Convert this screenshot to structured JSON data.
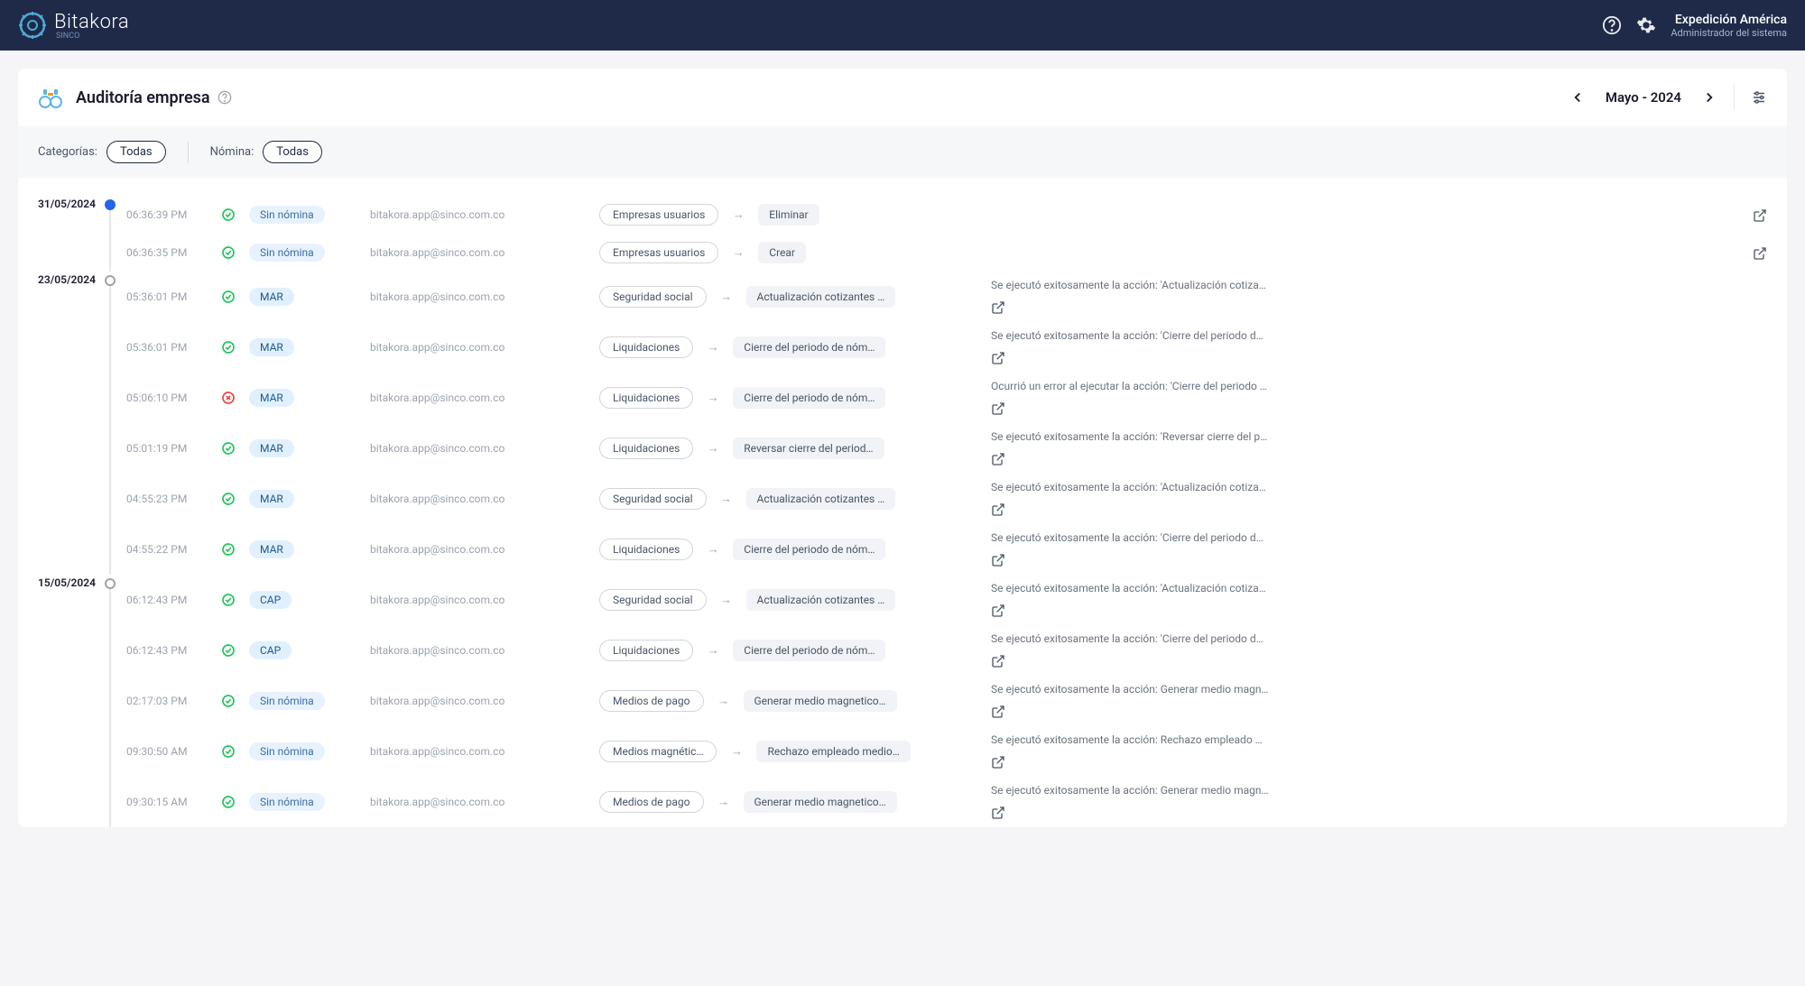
{
  "app": {
    "name": "Bitakora",
    "sub": "SINCO"
  },
  "user": {
    "name": "Expedición América",
    "role": "Administrador del sistema"
  },
  "page": {
    "title": "Auditoría empresa",
    "month": "Mayo - 2024",
    "filters": {
      "cat_label": "Categorías:",
      "cat_value": "Todas",
      "nom_label": "Nómina:",
      "nom_value": "Todas"
    }
  },
  "days": [
    {
      "date": "31/05/2024",
      "filled": true,
      "events": [
        {
          "time": "06:36:39 PM",
          "ok": true,
          "payroll": "Sin nómina",
          "user": "bitakora.app@sinco.com.co",
          "cat": "Empresas usuarios",
          "action": "Eliminar",
          "msg": "",
          "has_open": true
        },
        {
          "time": "06:36:35 PM",
          "ok": true,
          "payroll": "Sin nómina",
          "user": "bitakora.app@sinco.com.co",
          "cat": "Empresas usuarios",
          "action": "Crear",
          "msg": "",
          "has_open": true
        }
      ]
    },
    {
      "date": "23/05/2024",
      "filled": false,
      "events": [
        {
          "time": "05:36:01 PM",
          "ok": true,
          "payroll": "MAR",
          "user": "bitakora.app@sinco.com.co",
          "cat": "Seguridad social",
          "action": "Actualización cotizantes …",
          "msg": "Se ejecutó exitosamente la acción: 'Actualización cotiza…",
          "has_open": true
        },
        {
          "time": "05:36:01 PM",
          "ok": true,
          "payroll": "MAR",
          "user": "bitakora.app@sinco.com.co",
          "cat": "Liquidaciones",
          "action": "Cierre del periodo de nóm…",
          "msg": "Se ejecutó exitosamente la acción: 'Cierre del periodo d…",
          "has_open": true
        },
        {
          "time": "05:06:10 PM",
          "ok": false,
          "payroll": "MAR",
          "user": "bitakora.app@sinco.com.co",
          "cat": "Liquidaciones",
          "action": "Cierre del periodo de nóm…",
          "msg": "Ocurrió un error al ejecutar la acción: 'Cierre del periodo …",
          "has_open": true
        },
        {
          "time": "05:01:19 PM",
          "ok": true,
          "payroll": "MAR",
          "user": "bitakora.app@sinco.com.co",
          "cat": "Liquidaciones",
          "action": "Reversar cierre del period…",
          "msg": "Se ejecutó exitosamente la acción: 'Reversar cierre del p…",
          "has_open": true
        },
        {
          "time": "04:55:23 PM",
          "ok": true,
          "payroll": "MAR",
          "user": "bitakora.app@sinco.com.co",
          "cat": "Seguridad social",
          "action": "Actualización cotizantes …",
          "msg": "Se ejecutó exitosamente la acción: 'Actualización cotiza…",
          "has_open": true
        },
        {
          "time": "04:55:22 PM",
          "ok": true,
          "payroll": "MAR",
          "user": "bitakora.app@sinco.com.co",
          "cat": "Liquidaciones",
          "action": "Cierre del periodo de nóm…",
          "msg": "Se ejecutó exitosamente la acción: 'Cierre del periodo d…",
          "has_open": true
        }
      ]
    },
    {
      "date": "15/05/2024",
      "filled": false,
      "events": [
        {
          "time": "06:12:43 PM",
          "ok": true,
          "payroll": "CAP",
          "user": "bitakora.app@sinco.com.co",
          "cat": "Seguridad social",
          "action": "Actualización cotizantes …",
          "msg": "Se ejecutó exitosamente la acción: 'Actualización cotiza…",
          "has_open": true
        },
        {
          "time": "06:12:43 PM",
          "ok": true,
          "payroll": "CAP",
          "user": "bitakora.app@sinco.com.co",
          "cat": "Liquidaciones",
          "action": "Cierre del periodo de nóm…",
          "msg": "Se ejecutó exitosamente la acción: 'Cierre del periodo d…",
          "has_open": true
        },
        {
          "time": "02:17:03 PM",
          "ok": true,
          "payroll": "Sin nómina",
          "user": "bitakora.app@sinco.com.co",
          "cat": "Medios de pago",
          "action": "Generar medio magnetico…",
          "msg": "Se ejecutó exitosamente la acción: Generar medio magn…",
          "has_open": true
        },
        {
          "time": "09:30:50 AM",
          "ok": true,
          "payroll": "Sin nómina",
          "user": "bitakora.app@sinco.com.co",
          "cat": "Medios magnétic…",
          "action": "Rechazo empleado medio…",
          "msg": "Se ejecutó exitosamente la acción: Rechazo empleado …",
          "has_open": true
        },
        {
          "time": "09:30:15 AM",
          "ok": true,
          "payroll": "Sin nómina",
          "user": "bitakora.app@sinco.com.co",
          "cat": "Medios de pago",
          "action": "Generar medio magnetico…",
          "msg": "Se ejecutó exitosamente la acción: Generar medio magn…",
          "has_open": true
        }
      ]
    }
  ]
}
